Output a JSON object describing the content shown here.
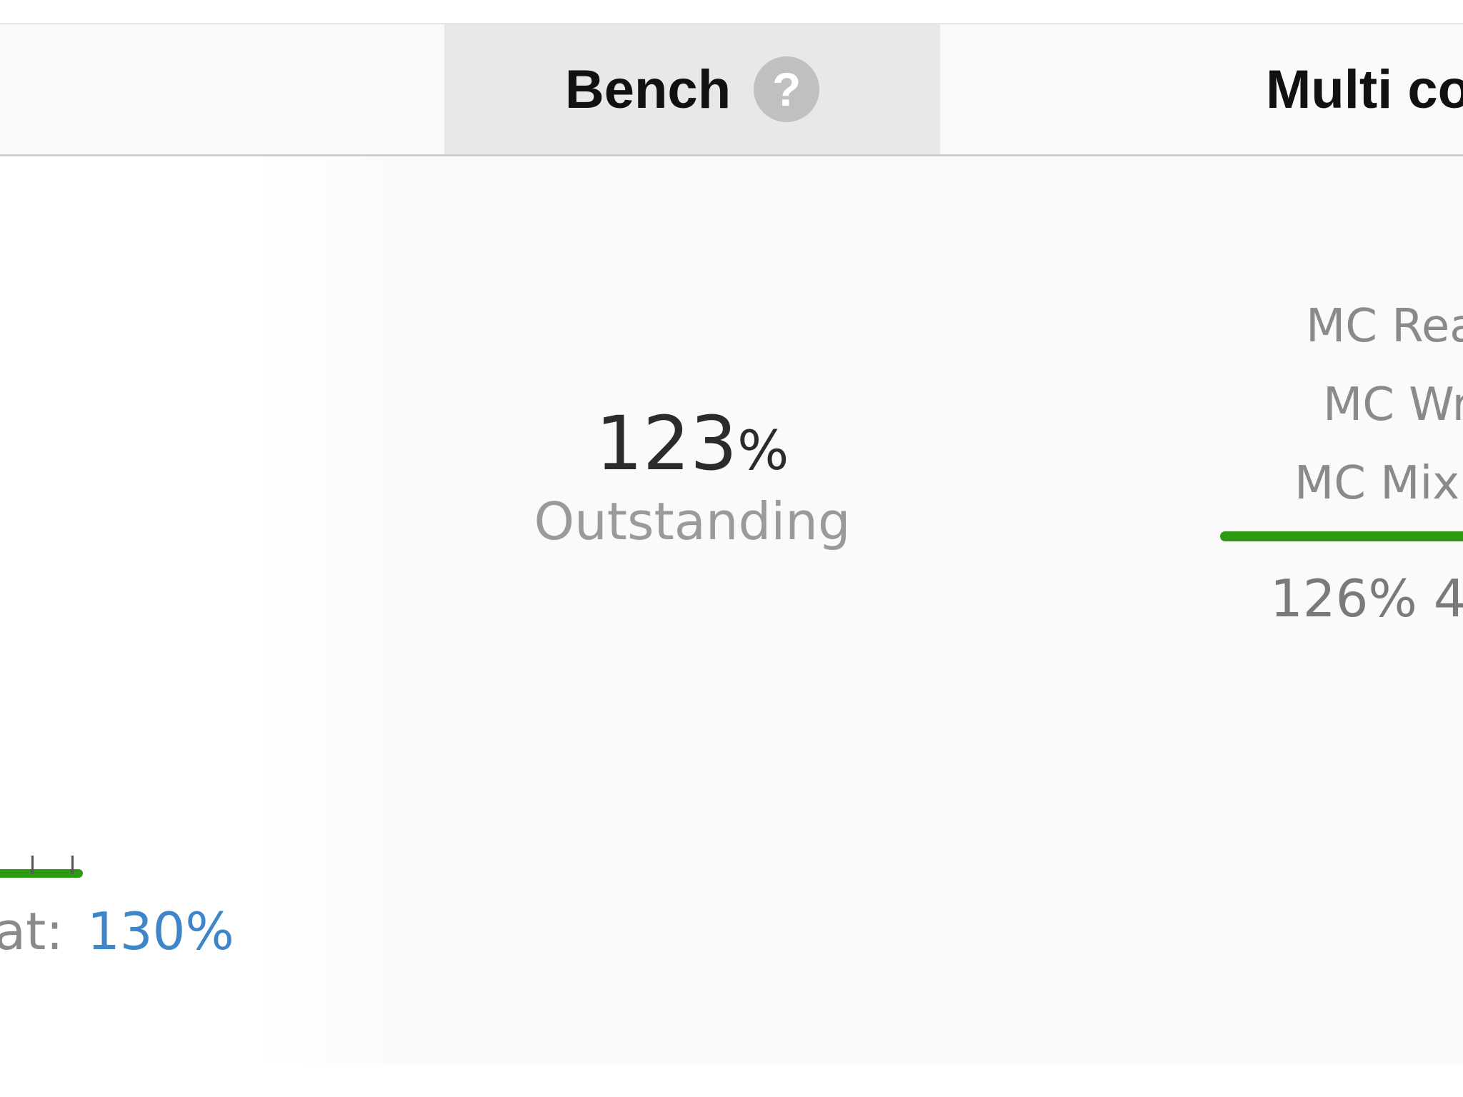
{
  "header": {
    "bench_title": "Bench",
    "help_glyph": "?",
    "multi_title": "Multi co"
  },
  "left_column": {
    "label_fragment": "at:",
    "value": "130%"
  },
  "bench": {
    "score_number": "123",
    "score_unit": "%",
    "rating": "Outstanding"
  },
  "multi_core": {
    "items": [
      "MC Rea",
      "MC Wr",
      "MC Mix"
    ],
    "values_fragment": "126% 4"
  },
  "colors": {
    "accent_green": "#2e9a12",
    "value_blue": "#3f86c8",
    "header_highlight": "#e8e8e8"
  }
}
